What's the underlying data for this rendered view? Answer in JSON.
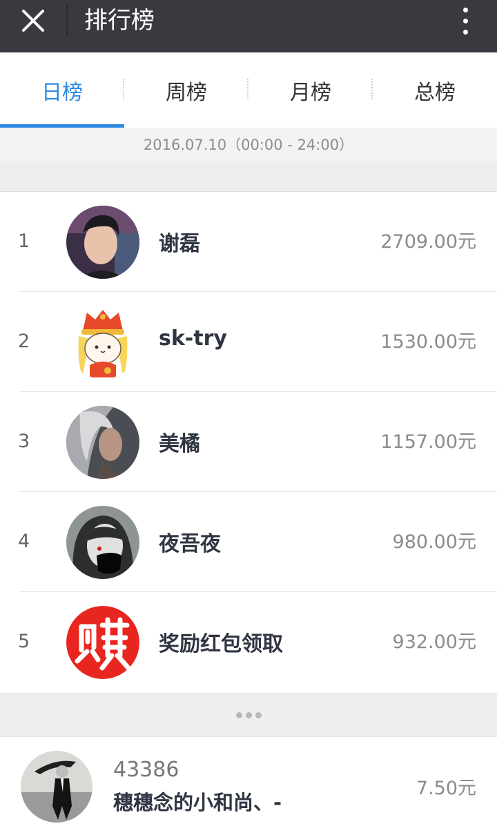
{
  "header": {
    "title": "排行榜",
    "close_icon": "close-icon",
    "more_icon": "more-vertical-icon"
  },
  "tabs": [
    {
      "label": "日榜",
      "active": true
    },
    {
      "label": "周榜",
      "active": false
    },
    {
      "label": "月榜",
      "active": false
    },
    {
      "label": "总榜",
      "active": false
    }
  ],
  "date_range": "2016.07.10（00:00 - 24:00）",
  "ranking": [
    {
      "rank": "1",
      "name": "谢磊",
      "amount": "2709.00元"
    },
    {
      "rank": "2",
      "name": "sk-try",
      "amount": "1530.00元"
    },
    {
      "rank": "3",
      "name": "美橘",
      "amount": "1157.00元"
    },
    {
      "rank": "4",
      "name": "夜吾夜",
      "amount": "980.00元"
    },
    {
      "rank": "5",
      "name": "奖励红包领取",
      "amount": "932.00元"
    }
  ],
  "more_indicator": "ellipsis-icon",
  "me": {
    "rank": "43386",
    "name": "穗穗念的小和尚、-",
    "amount": "7.50元"
  },
  "colors": {
    "header_bg": "#393a3f",
    "accent": "#2d8ae0",
    "red_badge": "#e8261f"
  }
}
